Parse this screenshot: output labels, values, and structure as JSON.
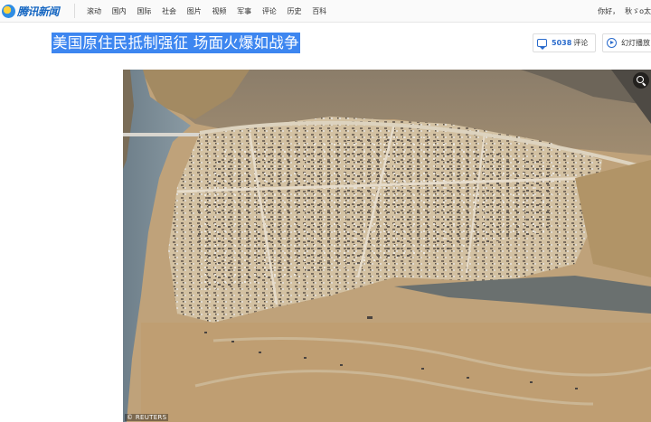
{
  "header": {
    "logo_text": "腾讯新闻",
    "nav_items": [
      "滚动",
      "国内",
      "国际",
      "社会",
      "图片",
      "视频",
      "军事",
      "评论",
      "历史",
      "百科"
    ],
    "greeting": "你好，",
    "user_name": "秋ゞo太"
  },
  "article": {
    "title": "美国原住民抵制强征 场面火爆如战争",
    "comment_count": "5038",
    "comment_label": "评论",
    "slideshow_label": "幻灯播放"
  },
  "photo": {
    "credit": "© REUTERS"
  },
  "colors": {
    "title_highlight": "#3d86f0",
    "accent_blue": "#2a6bcc"
  }
}
